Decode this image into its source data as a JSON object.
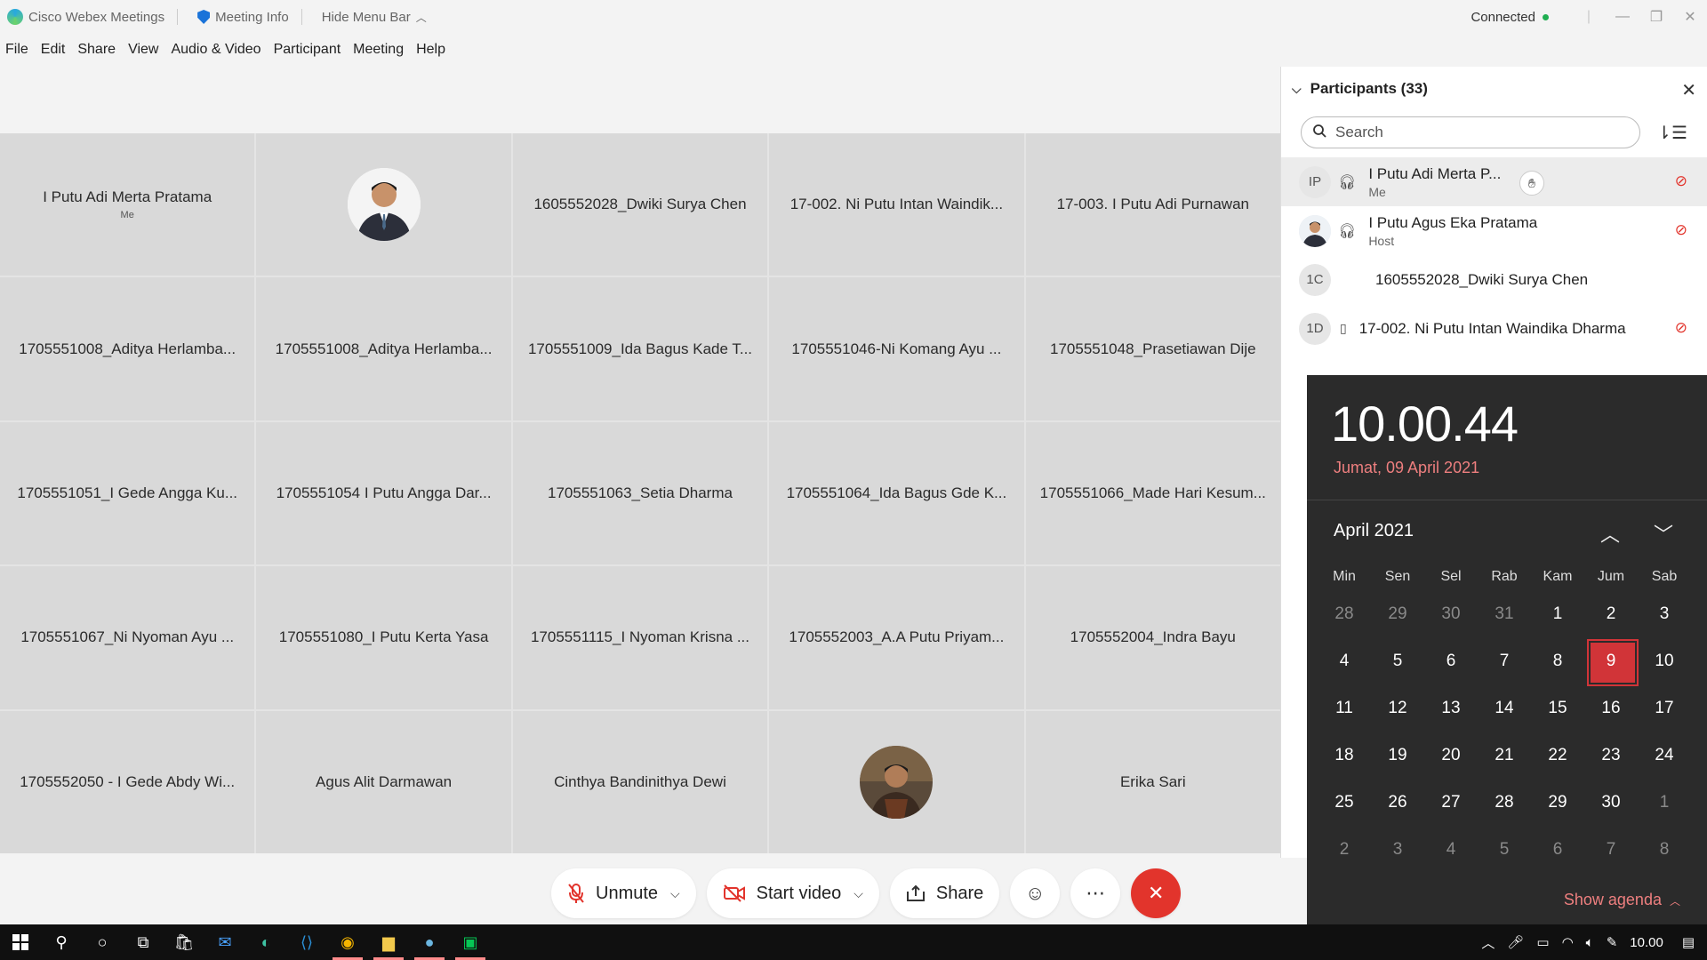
{
  "titlebar": {
    "app_name": "Cisco Webex Meetings",
    "meeting_info": "Meeting Info",
    "hide_menu": "Hide Menu Bar",
    "status": "Connected",
    "status_color": "#1fae51"
  },
  "menu": [
    "File",
    "Edit",
    "Share",
    "View",
    "Audio & Video",
    "Participant",
    "Meeting",
    "Help"
  ],
  "tiles": [
    {
      "name": "I Putu Adi Merta Pratama",
      "sub": "Me"
    },
    {
      "name": "",
      "photo": "avatar-photo-host"
    },
    {
      "name": "1605552028_Dwiki Surya Chen"
    },
    {
      "name": "17-002. Ni Putu Intan Waindik..."
    },
    {
      "name": "17-003. I Putu Adi Purnawan"
    },
    {
      "name": "1705551008_Aditya Herlamba..."
    },
    {
      "name": "1705551008_Aditya Herlamba..."
    },
    {
      "name": "1705551009_Ida Bagus Kade T..."
    },
    {
      "name": "1705551046-Ni Komang Ayu ..."
    },
    {
      "name": "1705551048_Prasetiawan Dije"
    },
    {
      "name": "1705551051_I Gede Angga Ku..."
    },
    {
      "name": "1705551054 I Putu Angga Dar..."
    },
    {
      "name": "1705551063_Setia Dharma"
    },
    {
      "name": "1705551064_Ida Bagus Gde K..."
    },
    {
      "name": "1705551066_Made Hari Kesum..."
    },
    {
      "name": "1705551067_Ni Nyoman Ayu ..."
    },
    {
      "name": "1705551080_I Putu Kerta Yasa"
    },
    {
      "name": "1705551115_I Nyoman Krisna ..."
    },
    {
      "name": "1705552003_A.A Putu Priyam..."
    },
    {
      "name": "1705552004_Indra Bayu"
    },
    {
      "name": "1705552050 - I Gede Abdy Wi..."
    },
    {
      "name": "Agus Alit Darmawan"
    },
    {
      "name": "Cinthya Bandinithya Dewi"
    },
    {
      "name": "",
      "photo": "avatar-photo-participant"
    },
    {
      "name": "Erika Sari"
    }
  ],
  "controls": {
    "unmute": "Unmute",
    "start_video": "Start video",
    "share": "Share",
    "end_color": "#e2342c"
  },
  "participants": {
    "title": "Participants (33)",
    "search_placeholder": "Search",
    "list": [
      {
        "initials": "IP",
        "name": "I Putu Adi Merta P...",
        "role": "Me"
      },
      {
        "initials": "",
        "name": "I Putu Agus Eka Pratama",
        "role": "Host"
      },
      {
        "initials": "1C",
        "name": "1605552028_Dwiki Surya Chen",
        "role": ""
      },
      {
        "initials": "1D",
        "name": "17-002. Ni Putu Intan Waindika Dharma",
        "role": ""
      }
    ]
  },
  "clock": {
    "time": "10.00.44",
    "date": "Jumat, 09 April 2021",
    "month": "April 2021",
    "weekdays": [
      "Min",
      "Sen",
      "Sel",
      "Rab",
      "Kam",
      "Jum",
      "Sab"
    ],
    "days": [
      [
        "28",
        "29",
        "30",
        "31",
        "1",
        "2",
        "3"
      ],
      [
        "4",
        "5",
        "6",
        "7",
        "8",
        "9",
        "10"
      ],
      [
        "11",
        "12",
        "13",
        "14",
        "15",
        "16",
        "17"
      ],
      [
        "18",
        "19",
        "20",
        "21",
        "22",
        "23",
        "24"
      ],
      [
        "25",
        "26",
        "27",
        "28",
        "29",
        "30",
        "1"
      ],
      [
        "2",
        "3",
        "4",
        "5",
        "6",
        "7",
        "8"
      ]
    ],
    "today": "9",
    "show_agenda": "Show agenda",
    "accent": "#d13438"
  },
  "taskbar": {
    "time": "10.00"
  }
}
